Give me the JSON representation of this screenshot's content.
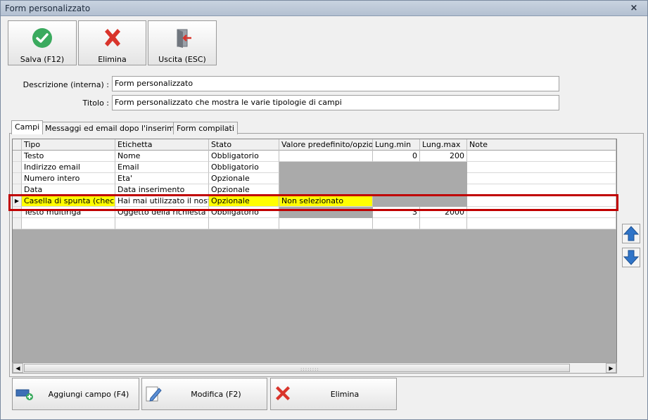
{
  "window": {
    "title": "Form personalizzato",
    "close_glyph": "×"
  },
  "toolbar": {
    "save_label": "Salva (F12)",
    "delete_label": "Elimina",
    "exit_label": "Uscita (ESC)"
  },
  "form": {
    "description_label": "Descrizione (interna) :",
    "description_value": "Form personalizzato",
    "title_label": "Titolo :",
    "title_value": "Form personalizzato che mostra le varie tipologie di campi"
  },
  "tabs": [
    {
      "label": "Campi"
    },
    {
      "label": "Messaggi ed email dopo l'inserimento"
    },
    {
      "label": "Form compilati"
    }
  ],
  "grid": {
    "columns": [
      "Tipo",
      "Etichetta",
      "Stato",
      "Valore predefinito/opzioni",
      "Lung.min",
      "Lung.max",
      "Note"
    ],
    "rows": [
      {
        "tipo": "Testo",
        "etichetta": "Nome",
        "stato": "Obbligatorio",
        "valore": "",
        "min": "0",
        "max": "200",
        "note": ""
      },
      {
        "tipo": "Indirizzo email",
        "etichetta": "Email",
        "stato": "Obbligatorio",
        "valore": "",
        "min": "",
        "max": "",
        "note": ""
      },
      {
        "tipo": "Numero intero",
        "etichetta": "Eta'",
        "stato": "Opzionale",
        "valore": "",
        "min": "",
        "max": "",
        "note": ""
      },
      {
        "tipo": "Data",
        "etichetta": "Data inserimento",
        "stato": "Opzionale",
        "valore": "",
        "min": "",
        "max": "",
        "note": ""
      },
      {
        "tipo": "Casella di spunta (check…",
        "etichetta": "Hai mai utilizzato il nostr…",
        "stato": "Opzionale",
        "valore": "Non selezionato",
        "min": "",
        "max": "",
        "note": ""
      },
      {
        "tipo": "Testo multiriga",
        "etichetta": "Oggetto della richiesta",
        "stato": "Obbligatorio",
        "valore": "",
        "min": "3",
        "max": "2000",
        "note": ""
      }
    ],
    "selected_row_marker": "▶"
  },
  "scrollbar": {
    "left_arrow": "◀",
    "right_arrow": "▶",
    "grip": "::::::::"
  },
  "bottom": {
    "add_label": "Aggiungi campo (F4)",
    "edit_label": "Modifica (F2)",
    "delete_label": "Elimina"
  },
  "colors": {
    "selection": "#ffff00",
    "highlight_border": "#c00000",
    "save_icon": "#3aaa5e",
    "delete_icon": "#d9342b",
    "arrow_icon": "#2f74c8"
  },
  "icons": {
    "save": "check-circle-icon",
    "delete": "x-icon",
    "exit": "door-exit-icon",
    "add": "add-field-icon",
    "edit": "pencil-edit-icon",
    "up": "arrow-up-icon",
    "down": "arrow-down-icon"
  }
}
